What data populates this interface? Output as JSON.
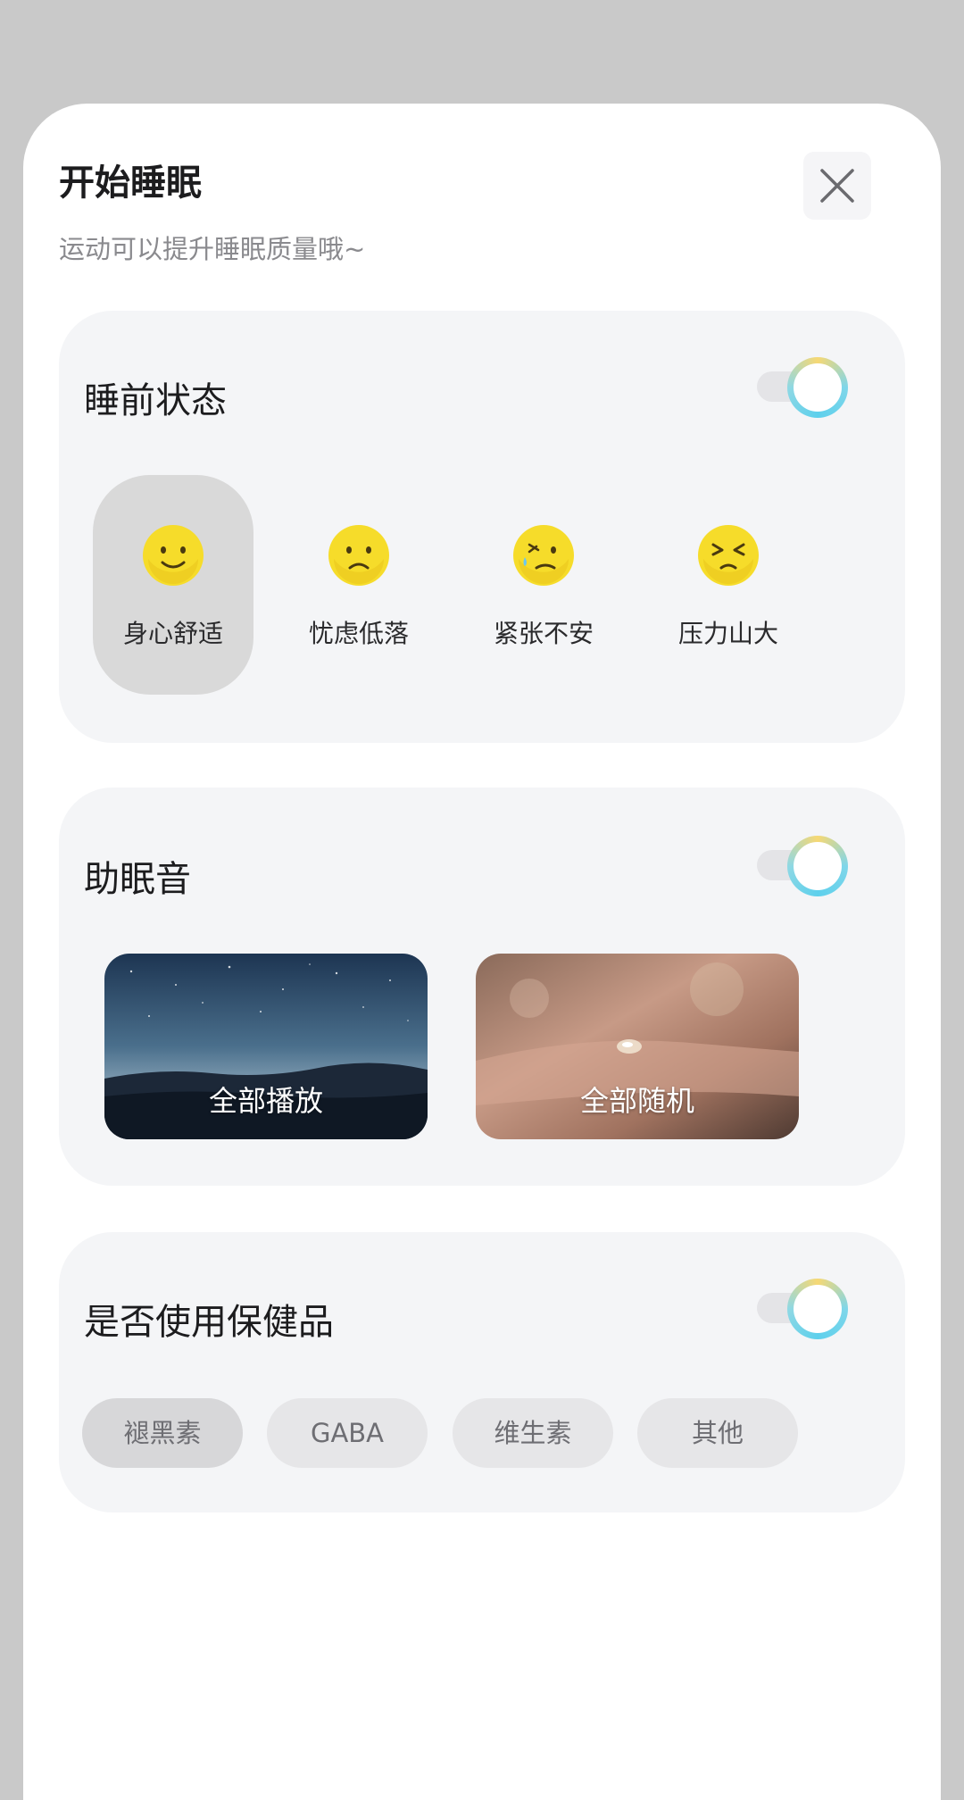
{
  "header": {
    "title": "开始睡眠",
    "subtitle": "运动可以提升睡眠质量哦~"
  },
  "mood_section": {
    "title": "睡前状态",
    "toggle_on": true,
    "items": [
      {
        "label": "身心舒适",
        "icon": "smile-face-icon",
        "selected": true
      },
      {
        "label": "忧虑低落",
        "icon": "sad-face-icon",
        "selected": false
      },
      {
        "label": "紧张不安",
        "icon": "anxious-face-icon",
        "selected": false
      },
      {
        "label": "压力山大",
        "icon": "stressed-face-icon",
        "selected": false
      }
    ]
  },
  "sound_section": {
    "title": "助眠音",
    "toggle_on": true,
    "items": [
      {
        "label": "全部播放",
        "image": "starry-night-mountains"
      },
      {
        "label": "全部随机",
        "image": "water-droplet-on-petal"
      }
    ]
  },
  "supplement_section": {
    "title": "是否使用保健品",
    "toggle_on": true,
    "options": [
      {
        "label": "褪黑素",
        "selected": true
      },
      {
        "label": "GABA",
        "selected": false
      },
      {
        "label": "维生素",
        "selected": false
      },
      {
        "label": "其他",
        "selected": false
      }
    ]
  },
  "colors": {
    "overlay": "#c9c9c9",
    "card_bg": "#f4f5f7",
    "emoji_yellow": "#f6dc2a",
    "toggle_ring_blue": "#5ed0ec",
    "toggle_ring_yellow": "#f6d874"
  }
}
